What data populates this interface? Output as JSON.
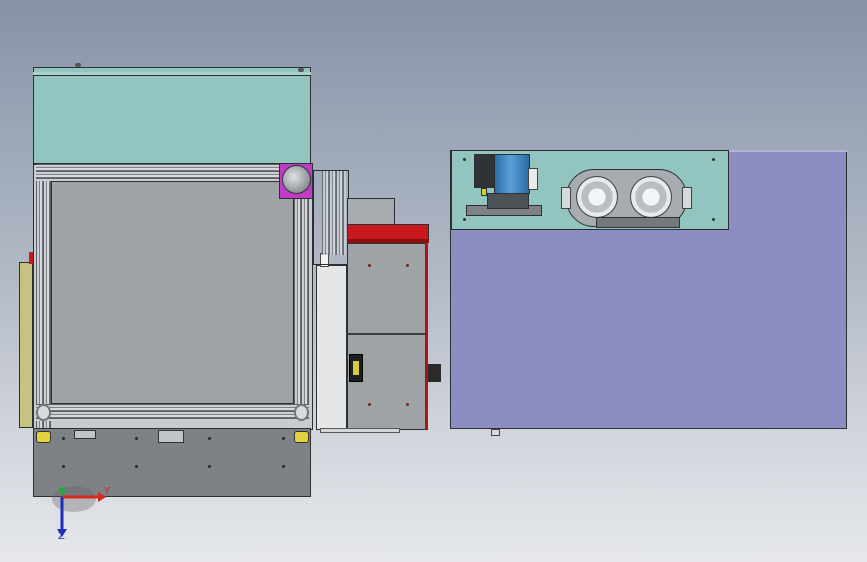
{
  "viewport": {
    "background_top": "#8592a7",
    "background_bottom": "#e6e8ec"
  },
  "triad": {
    "y_label": "Y",
    "z_label": "Z",
    "y_color": "#d42a1e",
    "z_color": "#1c2fb8",
    "x_color": "#2da642"
  },
  "colors": {
    "teal_cover": "#92c4c0",
    "panel_gray": "#9ea3a6",
    "cabinet_purple": "#8c8dc0",
    "red_strip": "#c8191e",
    "magenta_bracket": "#c23ac8",
    "motor_blue": "#3d86c4",
    "yellow_panel": "#c6c282"
  }
}
